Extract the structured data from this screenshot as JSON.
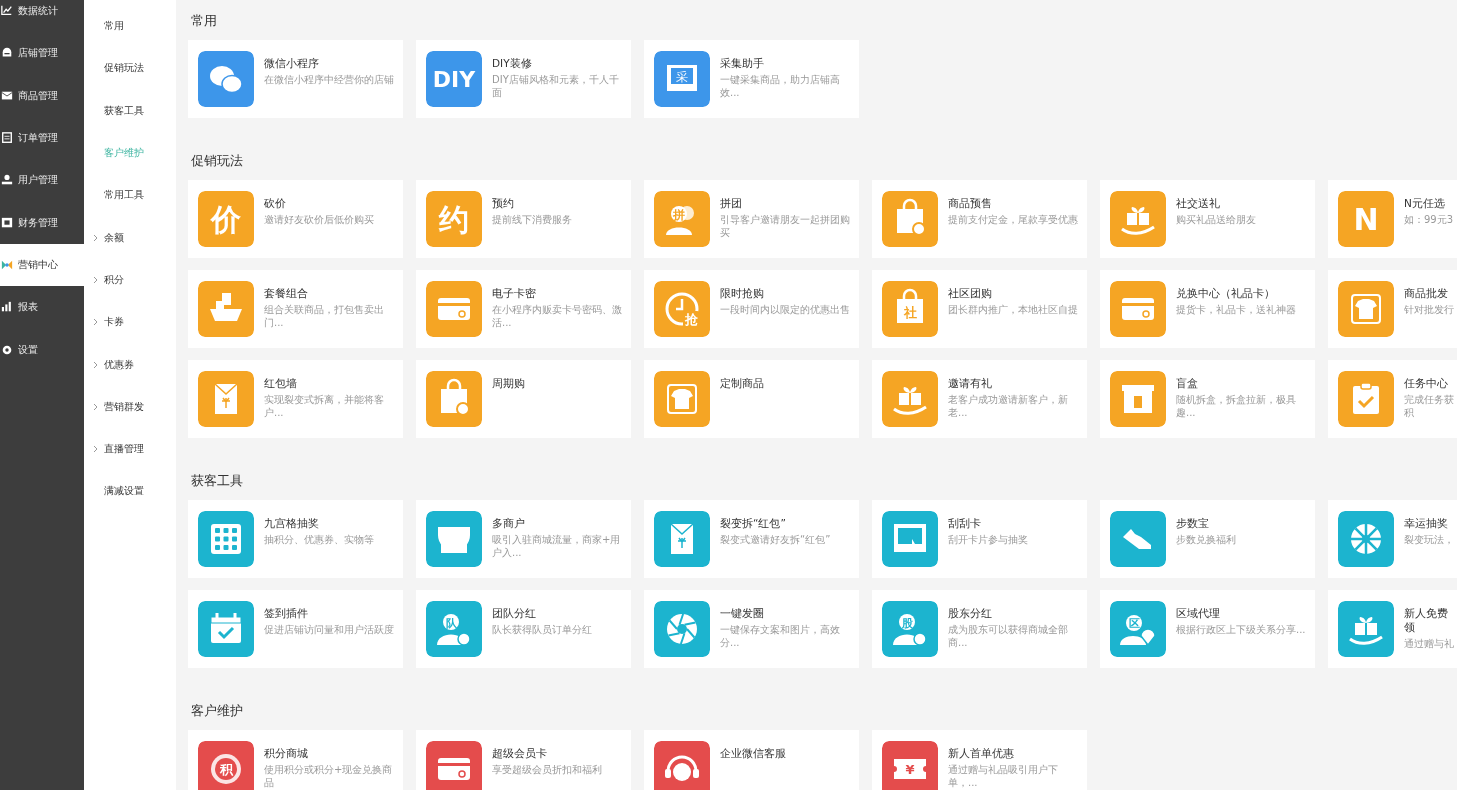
{
  "sidebar": {
    "items": [
      {
        "label": "数据统计",
        "kind": "chart",
        "selected": false
      },
      {
        "label": "店铺管理",
        "kind": "shop",
        "selected": false
      },
      {
        "label": "商品管理",
        "kind": "mail",
        "selected": false
      },
      {
        "label": "订单管理",
        "kind": "list",
        "selected": false
      },
      {
        "label": "用户管理",
        "kind": "user",
        "selected": false
      },
      {
        "label": "财务管理",
        "kind": "finance",
        "selected": false
      },
      {
        "label": "营销中心",
        "kind": "marketing",
        "selected": true
      },
      {
        "label": "报表",
        "kind": "report",
        "selected": false
      },
      {
        "label": "设置",
        "kind": "gear",
        "selected": false
      }
    ]
  },
  "subnav": {
    "items": [
      {
        "label": "常用",
        "selected": false,
        "expandable": false
      },
      {
        "label": "促销玩法",
        "selected": false,
        "expandable": false
      },
      {
        "label": "获客工具",
        "selected": false,
        "expandable": false
      },
      {
        "label": "客户维护",
        "selected": true,
        "expandable": false
      },
      {
        "label": "常用工具",
        "selected": false,
        "expandable": false
      },
      {
        "label": "余额",
        "selected": false,
        "expandable": true
      },
      {
        "label": "积分",
        "selected": false,
        "expandable": true
      },
      {
        "label": "卡券",
        "selected": false,
        "expandable": true
      },
      {
        "label": "优惠券",
        "selected": false,
        "expandable": true
      },
      {
        "label": "营销群发",
        "selected": false,
        "expandable": true
      },
      {
        "label": "直播管理",
        "selected": false,
        "expandable": true
      },
      {
        "label": "满减设置",
        "selected": false,
        "expandable": false
      }
    ]
  },
  "sections": [
    {
      "title": "常用",
      "color": "#3d96ea",
      "cards": [
        {
          "title": "微信小程序",
          "description": "在微信小程序中经营你的店铺",
          "kind": "chat"
        },
        {
          "title": "DIY装修",
          "description": "DIY店铺风格和元素，千人千面",
          "kind": "text",
          "glyph": "DIY"
        },
        {
          "title": "采集助手",
          "description": "一键采集商品，助力店铺高效...",
          "kind": "frame",
          "glyph": "采"
        }
      ]
    },
    {
      "title": "促销玩法",
      "color": "#f5a524",
      "cards": [
        {
          "title": "砍价",
          "description": "邀请好友砍价后低价购买",
          "kind": "text",
          "glyph": "价"
        },
        {
          "title": "预约",
          "description": "提前线下消费服务",
          "kind": "text",
          "glyph": "约"
        },
        {
          "title": "拼团",
          "description": "引导客户邀请朋友一起拼团购买",
          "kind": "people",
          "glyph": "拼"
        },
        {
          "title": "商品预售",
          "description": "提前支付定金，尾款享受优惠",
          "kind": "bag"
        },
        {
          "title": "社交送礼",
          "description": "购买礼品送给朋友",
          "kind": "gift"
        },
        {
          "title": "N元任选",
          "description": "如：99元3",
          "kind": "text",
          "glyph": "N"
        },
        {
          "title": "套餐组合",
          "description": "组合关联商品，打包售卖出门...",
          "kind": "ship"
        },
        {
          "title": "电子卡密",
          "description": "在小程序内贩卖卡号密码、激活...",
          "kind": "card"
        },
        {
          "title": "限时抢购",
          "description": "一段时间内以限定的优惠出售",
          "kind": "clock",
          "glyph": "抢"
        },
        {
          "title": "社区团购",
          "description": "团长群内推广，本地社区自提",
          "kind": "bag",
          "glyph": "社"
        },
        {
          "title": "兑换中心（礼品卡）",
          "description": "提货卡，礼品卡，送礼神器",
          "kind": "card"
        },
        {
          "title": "商品批发",
          "description": "针对批发行",
          "kind": "shirt"
        },
        {
          "title": "红包墙",
          "description": "实现裂变式拆离，并能将客户...",
          "kind": "envelope"
        },
        {
          "title": "周期购",
          "kind": "bag"
        },
        {
          "title": "定制商品",
          "kind": "shirt"
        },
        {
          "title": "邀请有礼",
          "description": "老客户成功邀请新客户，新老...",
          "kind": "gift"
        },
        {
          "title": "盲盒",
          "description": "随机拆盒，拆盒拉新，极具趣...",
          "kind": "box"
        },
        {
          "title": "任务中心",
          "description": "完成任务获积",
          "kind": "clipboard"
        }
      ]
    },
    {
      "title": "获客工具",
      "color": "#1cb4cf",
      "cards": [
        {
          "title": "九宫格抽奖",
          "description": "抽积分、优惠券、实物等",
          "kind": "grid"
        },
        {
          "title": "多商户",
          "description": "吸引入驻商城流量，商家+用户入...",
          "kind": "shop"
        },
        {
          "title": "裂变拆“红包”",
          "description": "裂变式邀请好友拆“红包”",
          "kind": "envelope"
        },
        {
          "title": "刮刮卡",
          "description": "刮开卡片参与抽奖",
          "kind": "screen"
        },
        {
          "title": "步数宝",
          "description": "步数兑换福利",
          "kind": "shoe"
        },
        {
          "title": "幸运抽奖",
          "description": "裂变玩法，",
          "kind": "wheel"
        },
        {
          "title": "签到插件",
          "description": "促进店铺访问量和用户活跃度",
          "kind": "calendar"
        },
        {
          "title": "团队分红",
          "description": "队长获得队员订单分红",
          "kind": "person",
          "glyph": "队"
        },
        {
          "title": "一键发圈",
          "description": "一键保存文案和图片，高效分...",
          "kind": "aperture"
        },
        {
          "title": "股东分红",
          "description": "成为股东可以获得商城全部商...",
          "kind": "person",
          "glyph": "股"
        },
        {
          "title": "区域代理",
          "description": "根据行政区上下级关系分享...",
          "kind": "pin",
          "glyph": "区"
        },
        {
          "title": "新人免费领",
          "description": "通过赠与礼",
          "kind": "gift"
        }
      ]
    },
    {
      "title": "客户维护",
      "color": "#e44c4c",
      "cards": [
        {
          "title": "积分商城",
          "description": "使用积分或积分+现金兑换商品",
          "kind": "badge",
          "glyph": "积"
        },
        {
          "title": "超级会员卡",
          "description": "享受超级会员折扣和福利",
          "kind": "card"
        },
        {
          "title": "企业微信客服",
          "kind": "headset"
        },
        {
          "title": "新人首单优惠",
          "description": "通过赠与礼品吸引用户下单，...",
          "kind": "ticket",
          "glyph": "¥"
        }
      ]
    }
  ]
}
